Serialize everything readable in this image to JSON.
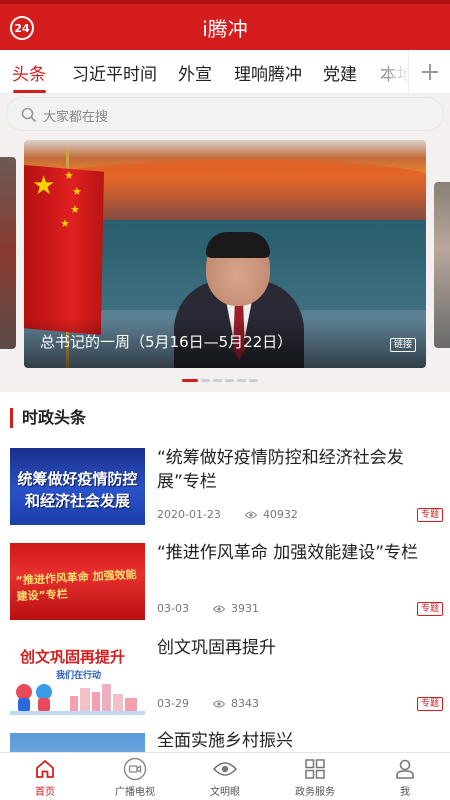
{
  "header": {
    "logo_badge": "24",
    "title": "i腾冲"
  },
  "tabs": [
    "头条",
    "习近平时间",
    "外宣",
    "理响腾冲",
    "党建",
    "本地"
  ],
  "search": {
    "placeholder": "大家都在搜"
  },
  "banner": {
    "caption": "总书记的一周（5月16日—5月22日）",
    "tag": "链接",
    "slide_count": 6,
    "active_slide": 1
  },
  "section": {
    "title": "时政头条"
  },
  "news": [
    {
      "title": "“统筹做好疫情防控和经济社会发展”专栏",
      "date": "2020-01-23",
      "views": "40932",
      "tag": "专题",
      "thumb_text": [
        "统筹做好疫情防控",
        "和经济社会发展"
      ]
    },
    {
      "title": "“推进作风革命 加强效能建设”专栏",
      "date": "03-03",
      "views": "3931",
      "tag": "专题",
      "thumb_text": [
        "“推进作风革命 加强效能建设”专栏"
      ]
    },
    {
      "title": "创文巩固再提升",
      "date": "03-29",
      "views": "8343",
      "tag": "专题",
      "thumb_text": [
        "创文巩固再提升",
        "我们在行动"
      ]
    },
    {
      "title": "全面实施乡村振兴"
    }
  ],
  "bottom_nav": [
    "首页",
    "广播电视",
    "文明眼",
    "政务服务",
    "我"
  ],
  "colors": {
    "brand_red": "#d51d1e",
    "text": "#222222",
    "muted": "#777777"
  }
}
